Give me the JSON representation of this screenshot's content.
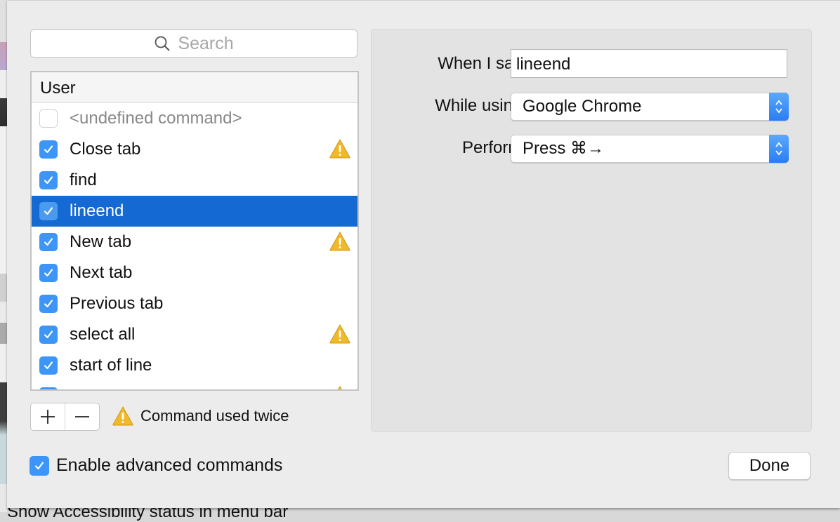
{
  "search": {
    "placeholder": "Search",
    "icon": "search-icon"
  },
  "list": {
    "header": "User",
    "items": [
      {
        "label": "<undefined command>",
        "checked": false,
        "warning": false,
        "selected": false
      },
      {
        "label": "Close tab",
        "checked": true,
        "warning": true,
        "selected": false
      },
      {
        "label": "find",
        "checked": true,
        "warning": false,
        "selected": false
      },
      {
        "label": "lineend",
        "checked": true,
        "warning": false,
        "selected": true
      },
      {
        "label": "New tab",
        "checked": true,
        "warning": true,
        "selected": false
      },
      {
        "label": "Next tab",
        "checked": true,
        "warning": false,
        "selected": false
      },
      {
        "label": "Previous tab",
        "checked": true,
        "warning": false,
        "selected": false
      },
      {
        "label": "select all",
        "checked": true,
        "warning": true,
        "selected": false
      },
      {
        "label": "start of line",
        "checked": true,
        "warning": false,
        "selected": false
      },
      {
        "label": "",
        "checked": true,
        "warning": true,
        "selected": false
      }
    ]
  },
  "controls": {
    "add_label": "+",
    "remove_label": "—",
    "legend_text": "Command used twice"
  },
  "advanced": {
    "label": "Enable advanced commands",
    "checked": true
  },
  "detail": {
    "when_label": "When I say:",
    "when_value": "lineend",
    "while_label": "While using:",
    "while_value": "Google Chrome",
    "perform_label": "Perform:",
    "perform_value": "Press ⌘→"
  },
  "done_label": "Done",
  "background_text": "Show Accessibility status in menu bar",
  "colors": {
    "accent": "#3d95f7",
    "selection": "#1569d2",
    "warning": "#f0b92a"
  }
}
